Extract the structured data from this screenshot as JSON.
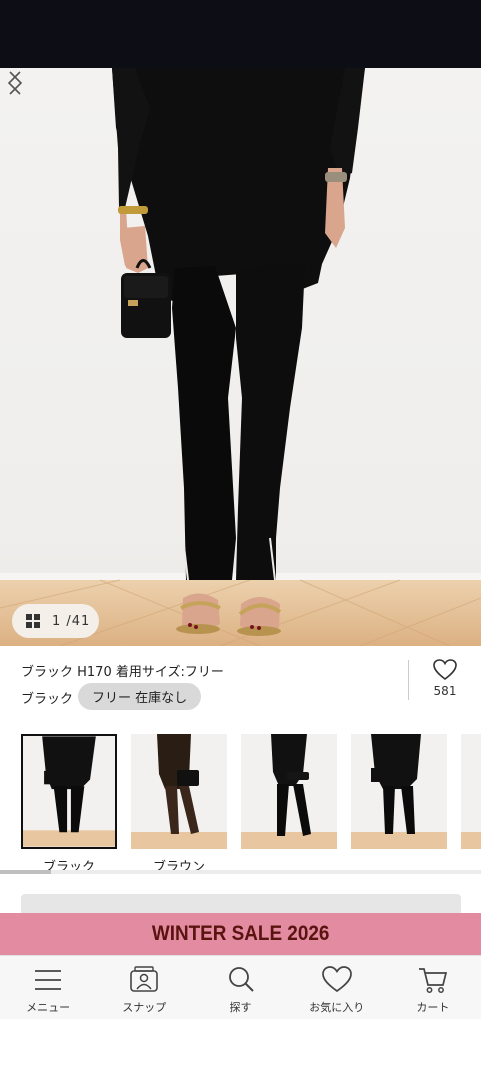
{
  "gallery": {
    "counter": "1 /41",
    "colors": {
      "wall": "#f1f0ee",
      "floor": "#e8c9a3",
      "garment": "#0e0e0e"
    }
  },
  "product": {
    "model_info": "ブラック H170 着用サイズ:フリー",
    "selected_color": "ブラック",
    "size_stock_chip": "フリー 在庫なし",
    "favorite_count": "581"
  },
  "color_variants": [
    {
      "label": "ブラック",
      "selected": true
    },
    {
      "label": "ブラウン",
      "selected": false
    },
    {
      "label": "",
      "selected": false
    },
    {
      "label": "",
      "selected": false
    }
  ],
  "banner": {
    "text": "WINTER SALE 2026",
    "bg": "#e28ba1",
    "fg": "#5a1410"
  },
  "tabbar": {
    "items": [
      {
        "label": "メニュー",
        "icon": "menu-icon"
      },
      {
        "label": "スナップ",
        "icon": "snap-icon"
      },
      {
        "label": "探す",
        "icon": "search-icon"
      },
      {
        "label": "お気に入り",
        "icon": "heart-icon"
      },
      {
        "label": "カート",
        "icon": "cart-icon"
      }
    ]
  }
}
